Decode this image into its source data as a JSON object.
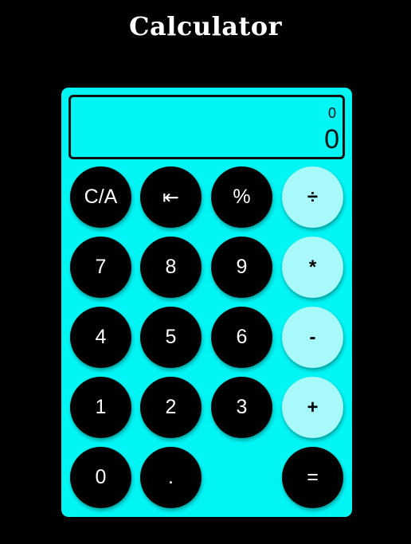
{
  "title": "Calculator",
  "display": {
    "previous": "0",
    "current": "0"
  },
  "keys": {
    "clear": "C/A",
    "backspace": "⇤",
    "percent": "%",
    "divide": "÷",
    "seven": "7",
    "eight": "8",
    "nine": "9",
    "multiply": "*",
    "four": "4",
    "five": "5",
    "six": "6",
    "subtract": "-",
    "one": "1",
    "two": "2",
    "three": "3",
    "add": "+",
    "zero": "0",
    "decimal": ".",
    "equals": "="
  },
  "colors": {
    "page_background": "#000000",
    "calculator_body": "#00f5f5",
    "number_key": "#000000",
    "operator_key": "#a8fafa"
  }
}
